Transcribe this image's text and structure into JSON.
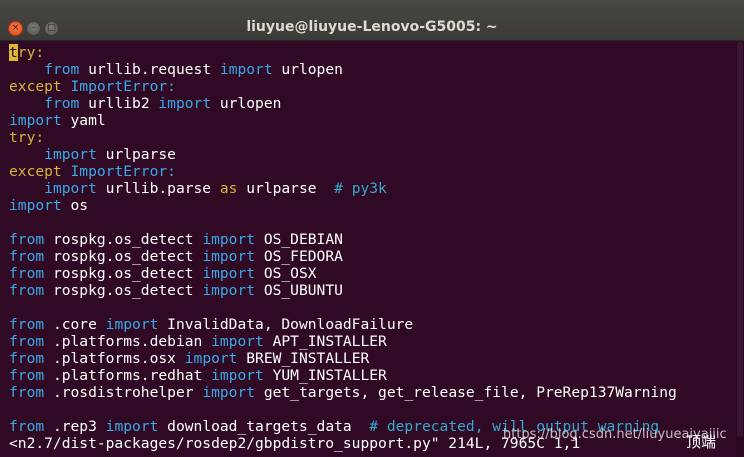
{
  "window": {
    "title": "liuyue@liuyue-Lenovo-G5005: ~",
    "controls": [
      {
        "name": "close",
        "glyph": "×"
      },
      {
        "name": "minimize",
        "glyph": "–"
      },
      {
        "name": "maximize",
        "glyph": "□"
      }
    ]
  },
  "terminal": {
    "lines": [
      {
        "segs": [
          {
            "t": "t",
            "c": "cursor"
          },
          {
            "t": "ry:",
            "c": "kw-y"
          }
        ]
      },
      {
        "segs": [
          {
            "t": "    "
          },
          {
            "t": "from",
            "c": "kw-b"
          },
          {
            "t": " urllib.request "
          },
          {
            "t": "import",
            "c": "kw-b"
          },
          {
            "t": " urlopen"
          }
        ]
      },
      {
        "segs": [
          {
            "t": "except",
            "c": "kw-y"
          },
          {
            "t": " "
          },
          {
            "t": "ImportError:",
            "c": "kw-b"
          }
        ]
      },
      {
        "segs": [
          {
            "t": "    "
          },
          {
            "t": "from",
            "c": "kw-b"
          },
          {
            "t": " urllib2 "
          },
          {
            "t": "import",
            "c": "kw-b"
          },
          {
            "t": " urlopen"
          }
        ]
      },
      {
        "segs": [
          {
            "t": "import",
            "c": "kw-b"
          },
          {
            "t": " yaml"
          }
        ]
      },
      {
        "segs": [
          {
            "t": "try:",
            "c": "kw-y"
          }
        ]
      },
      {
        "segs": [
          {
            "t": "    "
          },
          {
            "t": "import",
            "c": "kw-b"
          },
          {
            "t": " urlparse"
          }
        ]
      },
      {
        "segs": [
          {
            "t": "except",
            "c": "kw-y"
          },
          {
            "t": " "
          },
          {
            "t": "ImportError:",
            "c": "kw-b"
          }
        ]
      },
      {
        "segs": [
          {
            "t": "    "
          },
          {
            "t": "import",
            "c": "kw-b"
          },
          {
            "t": " urllib.parse "
          },
          {
            "t": "as",
            "c": "kw-y"
          },
          {
            "t": " urlparse  "
          },
          {
            "t": "# py3k",
            "c": "cm"
          }
        ]
      },
      {
        "segs": [
          {
            "t": "import",
            "c": "kw-b"
          },
          {
            "t": " os"
          }
        ]
      },
      {
        "segs": []
      },
      {
        "segs": [
          {
            "t": "from",
            "c": "kw-b"
          },
          {
            "t": " rospkg.os_detect "
          },
          {
            "t": "import",
            "c": "kw-b"
          },
          {
            "t": " OS_DEBIAN"
          }
        ]
      },
      {
        "segs": [
          {
            "t": "from",
            "c": "kw-b"
          },
          {
            "t": " rospkg.os_detect "
          },
          {
            "t": "import",
            "c": "kw-b"
          },
          {
            "t": " OS_FEDORA"
          }
        ]
      },
      {
        "segs": [
          {
            "t": "from",
            "c": "kw-b"
          },
          {
            "t": " rospkg.os_detect "
          },
          {
            "t": "import",
            "c": "kw-b"
          },
          {
            "t": " OS_OSX"
          }
        ]
      },
      {
        "segs": [
          {
            "t": "from",
            "c": "kw-b"
          },
          {
            "t": " rospkg.os_detect "
          },
          {
            "t": "import",
            "c": "kw-b"
          },
          {
            "t": " OS_UBUNTU"
          }
        ]
      },
      {
        "segs": []
      },
      {
        "segs": [
          {
            "t": "from",
            "c": "kw-b"
          },
          {
            "t": " .core "
          },
          {
            "t": "import",
            "c": "kw-b"
          },
          {
            "t": " InvalidData, DownloadFailure"
          }
        ]
      },
      {
        "segs": [
          {
            "t": "from",
            "c": "kw-b"
          },
          {
            "t": " .platforms.debian "
          },
          {
            "t": "import",
            "c": "kw-b"
          },
          {
            "t": " APT_INSTALLER"
          }
        ]
      },
      {
        "segs": [
          {
            "t": "from",
            "c": "kw-b"
          },
          {
            "t": " .platforms.osx "
          },
          {
            "t": "import",
            "c": "kw-b"
          },
          {
            "t": " BREW_INSTALLER"
          }
        ]
      },
      {
        "segs": [
          {
            "t": "from",
            "c": "kw-b"
          },
          {
            "t": " .platforms.redhat "
          },
          {
            "t": "import",
            "c": "kw-b"
          },
          {
            "t": " YUM_INSTALLER"
          }
        ]
      },
      {
        "segs": [
          {
            "t": "from",
            "c": "kw-b"
          },
          {
            "t": " .rosdistrohelper "
          },
          {
            "t": "import",
            "c": "kw-b"
          },
          {
            "t": " get_targets, get_release_file, PreRep137Warning"
          }
        ]
      },
      {
        "segs": []
      },
      {
        "segs": [
          {
            "t": "from",
            "c": "kw-b"
          },
          {
            "t": " .rep3 "
          },
          {
            "t": "import",
            "c": "kw-b"
          },
          {
            "t": " download_targets_data  "
          },
          {
            "t": "# deprecated, will output warning",
            "c": "cm"
          }
        ]
      },
      {
        "segs": [
          {
            "t": "<n2.7/dist-packages/rosdep2/gbpdistro_support.py\" 214L, 7965C 1,1"
          }
        ]
      }
    ]
  },
  "overlay": {
    "watermark": "https://blog.csdn.net/liuyueaiyajiic",
    "corner_text": "顶端"
  },
  "colors": {
    "background": "#300a24",
    "keyword_yellow": "#d7b33b",
    "keyword_blue": "#3aa8e6",
    "comment": "#36a8cf",
    "text": "#ffffff",
    "cursor": "#dcb934"
  }
}
